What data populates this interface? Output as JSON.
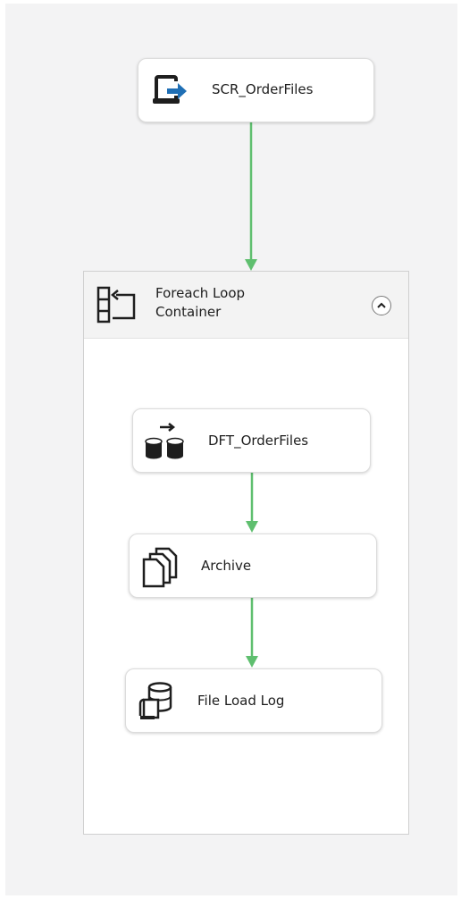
{
  "tasks": {
    "script_task": {
      "label": "SCR_OrderFiles",
      "icon": "script-task-icon"
    },
    "data_flow_task": {
      "label": "DFT_OrderFiles",
      "icon": "data-flow-icon"
    },
    "archive_task": {
      "label": "Archive",
      "icon": "file-system-icon"
    },
    "log_task": {
      "label": "File Load Log",
      "icon": "execute-sql-icon"
    }
  },
  "foreach_container": {
    "title": "Foreach Loop Container",
    "icon": "foreach-loop-icon",
    "collapse_icon": "chevron-up-icon"
  },
  "colors": {
    "canvas_bg": "#f3f3f4",
    "precedence_success": "#5fbf6f",
    "script_arrow": "#1f6fb5"
  }
}
